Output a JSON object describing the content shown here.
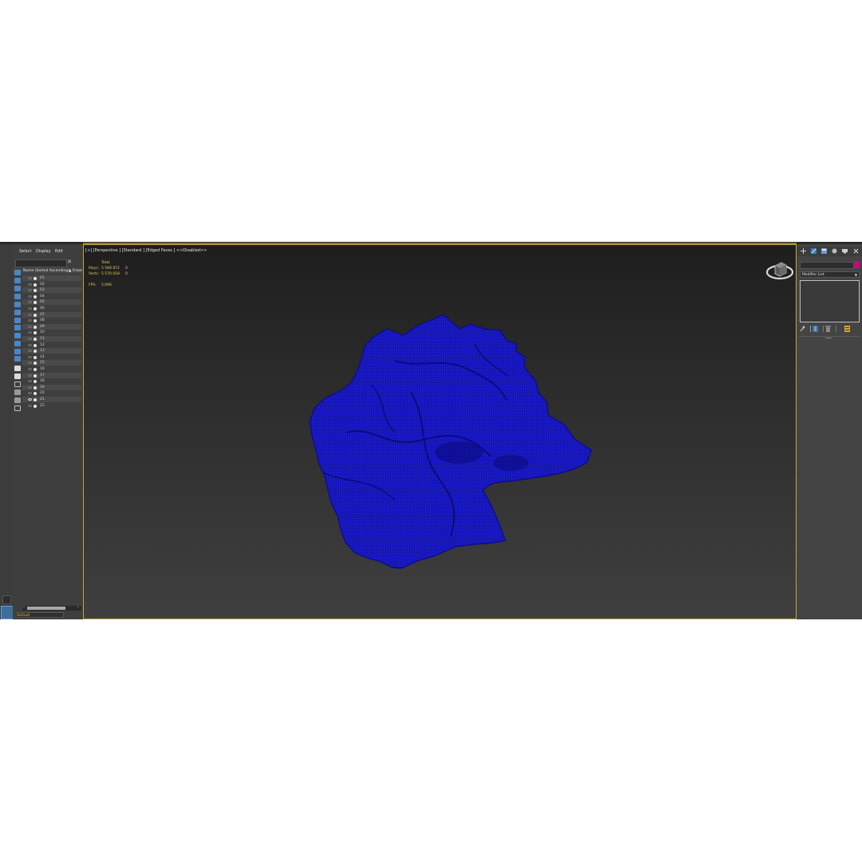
{
  "explorer": {
    "menu": [
      "Select",
      "Display",
      "Edit"
    ],
    "column_name": "Name (Sorted Ascending)",
    "column_frozen": "▲ Froze",
    "clear_icon": "close-icon",
    "items": [
      {
        "label": "01",
        "eye": false
      },
      {
        "label": "02",
        "eye": false
      },
      {
        "label": "03",
        "eye": false
      },
      {
        "label": "04",
        "eye": false
      },
      {
        "label": "05",
        "eye": false
      },
      {
        "label": "06",
        "eye": false
      },
      {
        "label": "07",
        "eye": false
      },
      {
        "label": "08",
        "eye": false
      },
      {
        "label": "09",
        "eye": false
      },
      {
        "label": "10",
        "eye": false
      },
      {
        "label": "11",
        "eye": false
      },
      {
        "label": "12",
        "eye": false
      },
      {
        "label": "13",
        "eye": false
      },
      {
        "label": "14",
        "eye": false
      },
      {
        "label": "15",
        "eye": false
      },
      {
        "label": "16",
        "eye": false
      },
      {
        "label": "17",
        "eye": false
      },
      {
        "label": "18",
        "eye": false
      },
      {
        "label": "19",
        "eye": false
      },
      {
        "label": "20",
        "eye": false
      },
      {
        "label": "21",
        "eye": true
      },
      {
        "label": "22",
        "eye": false
      }
    ],
    "layer": "Default"
  },
  "viewport": {
    "label": "[+] [Perspective ] [Standard ] [Edged Faces ]  <<Disabled>>",
    "stats": {
      "total_label": "Total",
      "polys_label": "Polys:",
      "polys_value": "5 569 872",
      "polys_sel": "0",
      "verts_label": "Verts:",
      "verts_value": "5 570 018",
      "verts_sel": "0",
      "fps_label": "FPS:",
      "fps_value": "5,096"
    },
    "mesh_color": "#1a1acc",
    "border_color": "#c7a53a"
  },
  "command_panel": {
    "modifier_list": "Modifier List",
    "swatch_color": "#d6007a",
    "tabs": [
      "create-icon",
      "modify-icon",
      "hierarchy-icon",
      "motion-icon",
      "display-icon",
      "utilities-icon"
    ]
  }
}
